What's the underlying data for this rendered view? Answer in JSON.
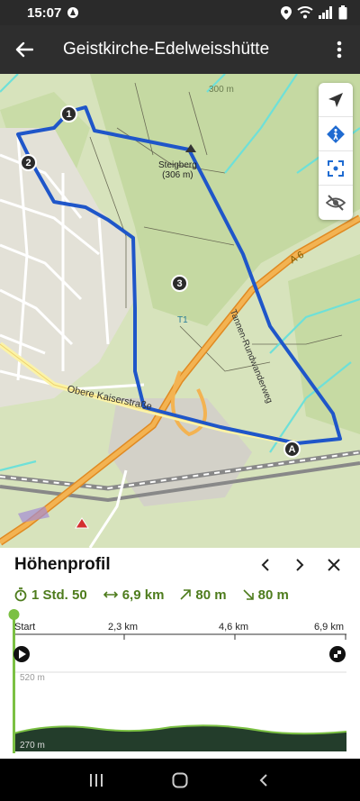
{
  "status_bar": {
    "time": "15:07"
  },
  "app_bar": {
    "title": "Geistkirche-Edelweisshütte"
  },
  "map": {
    "summit_name": "Steigberg",
    "summit_elevation": "(306 m)",
    "contour_label": "300 m",
    "trail_label": "Tannen-Rundwanderweg",
    "street_label": "Obere Kaiserstraße",
    "highway_label": "A 6",
    "marker_a": "A",
    "t1_label": "T1",
    "waypoints": [
      "1",
      "2",
      "3"
    ]
  },
  "panel": {
    "title": "Höhenprofil",
    "duration": "1 Std. 50",
    "distance": "6,9 km",
    "ascent": "80 m",
    "descent": "80 m",
    "axis_ticks": [
      "Start",
      "2,3 km",
      "4,6 km",
      "6,9 km"
    ],
    "elev_max": "520 m",
    "elev_min": "270 m"
  },
  "colors": {
    "route": "#1f56c9",
    "accent": "#4e7c1d",
    "highway": "#f0a640"
  }
}
